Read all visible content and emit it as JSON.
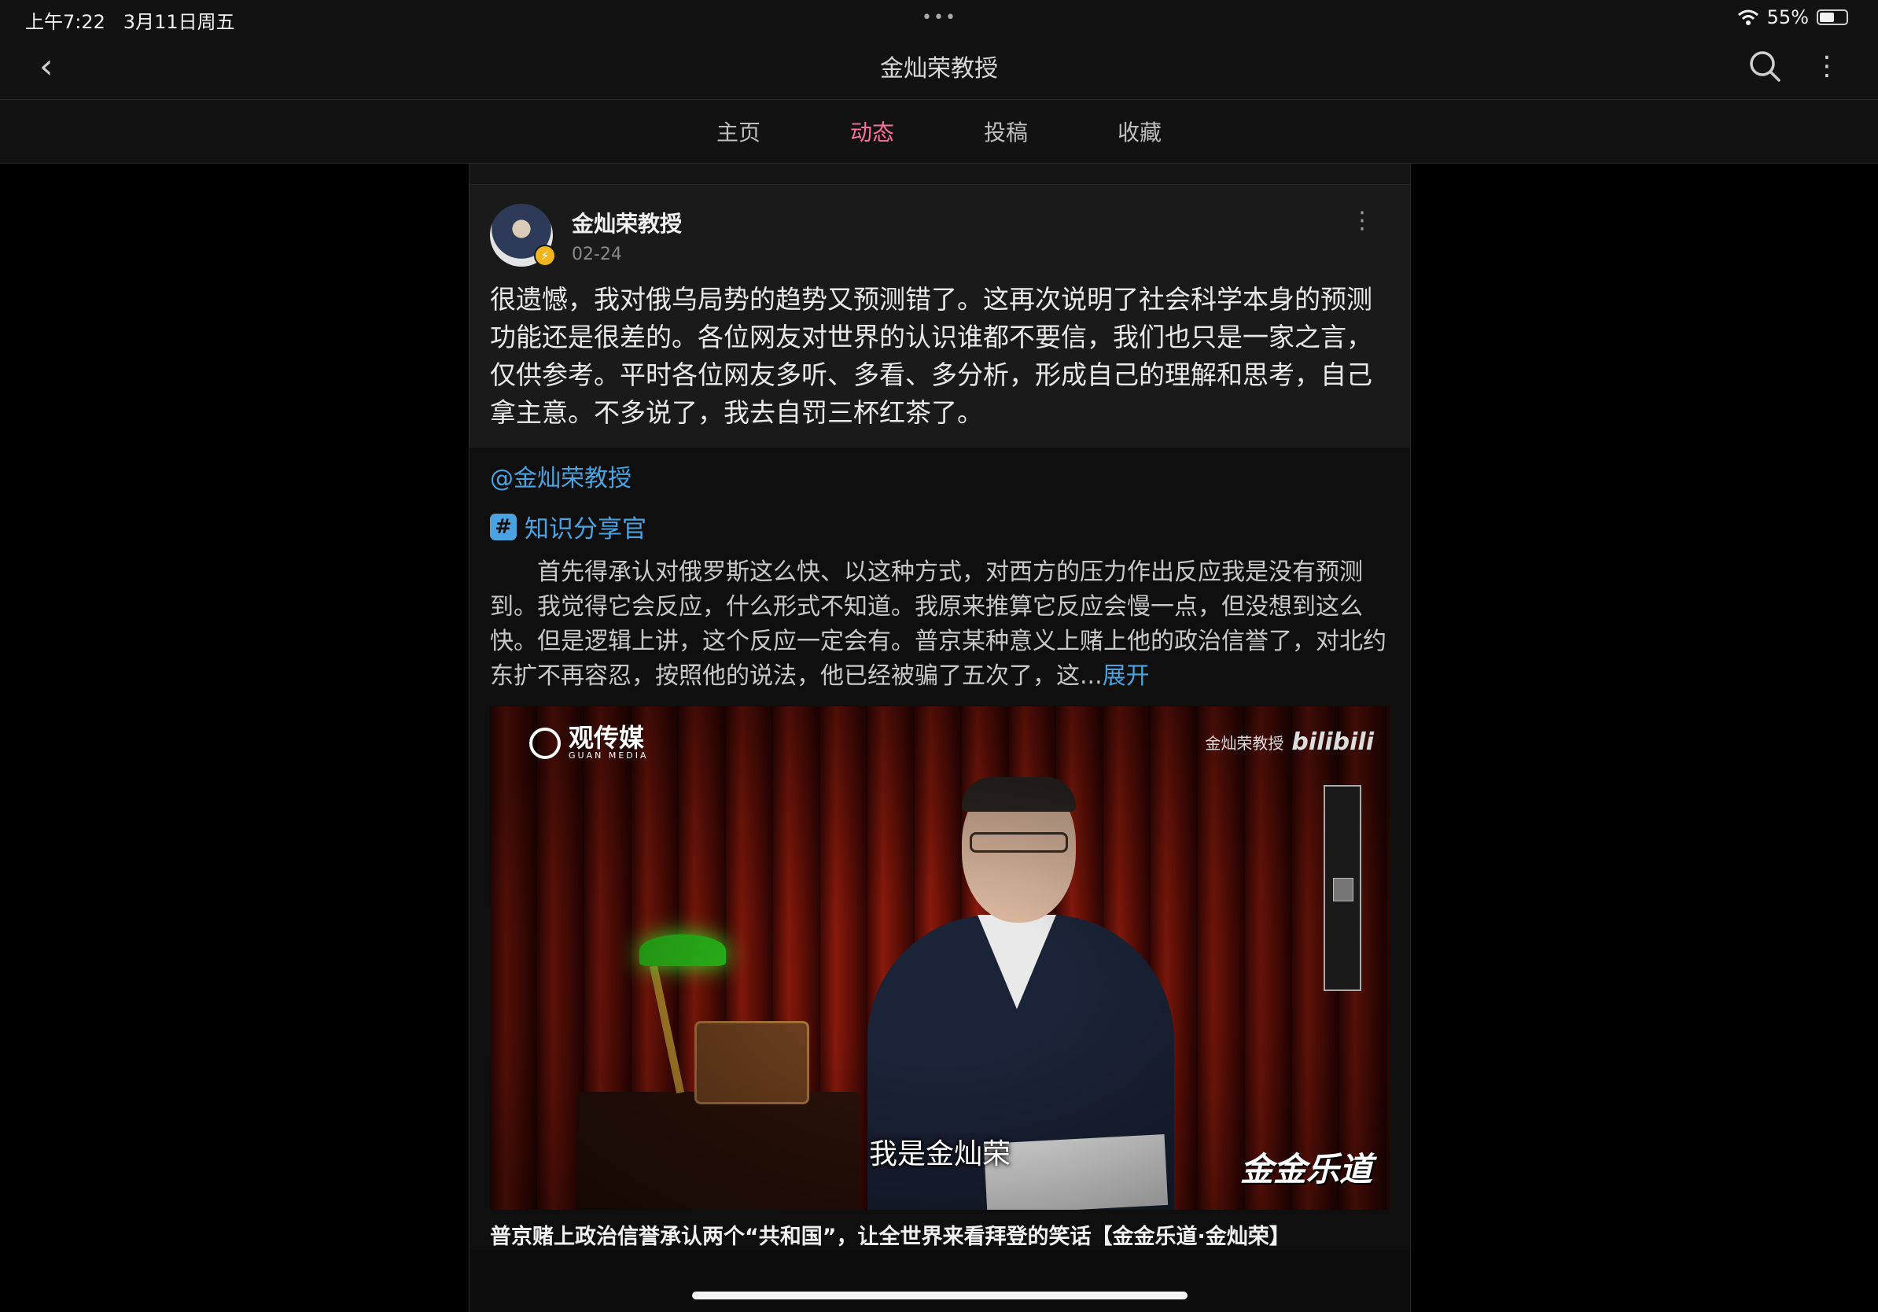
{
  "status": {
    "time": "上午7:22",
    "date": "3月11日周五",
    "battery": "55%",
    "battery_level": 0.55
  },
  "nav": {
    "title": "金灿荣教授"
  },
  "tabs": [
    {
      "label": "主页",
      "active": false
    },
    {
      "label": "动态",
      "active": true
    },
    {
      "label": "投稿",
      "active": false
    },
    {
      "label": "收藏",
      "active": false
    }
  ],
  "post": {
    "author": "金灿荣教授",
    "date": "02-24",
    "text": "很遗憾，我对俄乌局势的趋势又预测错了。这再次说明了社会科学本身的预测功能还是很差的。各位网友对世界的认识谁都不要信，我们也只是一家之言，仅供参考。平时各位网友多听、多看、多分析，形成自己的理解和思考，自己拿主意。不多说了，我去自罚三杯红茶了。"
  },
  "repost": {
    "mention": "@金灿荣教授",
    "topic": "知识分享官",
    "text": "首先得承认对俄罗斯这么快、以这种方式，对西方的压力作出反应我是没有预测到。我觉得它会反应，什么形式不知道。我原来推算它反应会慢一点，但没想到这么快。但是逻辑上讲，这个反应一定会有。普京某种意义上赌上他的政治信誉了，对北约东扩不再容忍，按照他的说法，他已经被骗了五次了，这...",
    "expand": "展开"
  },
  "video": {
    "brand_name": "观传媒",
    "brand_sub": "GUAN MEDIA",
    "watermark_author": "金灿荣教授",
    "watermark_logo": "bilibili",
    "subtitle": "我是金灿荣",
    "show_logo": "金金乐道",
    "title": "普京赌上政治信誉承认两个“共和国”，让全世界来看拜登的笑话【金金乐道·金灿荣】"
  },
  "colors": {
    "accent": "#fb7299",
    "link": "#4aa3e0"
  }
}
